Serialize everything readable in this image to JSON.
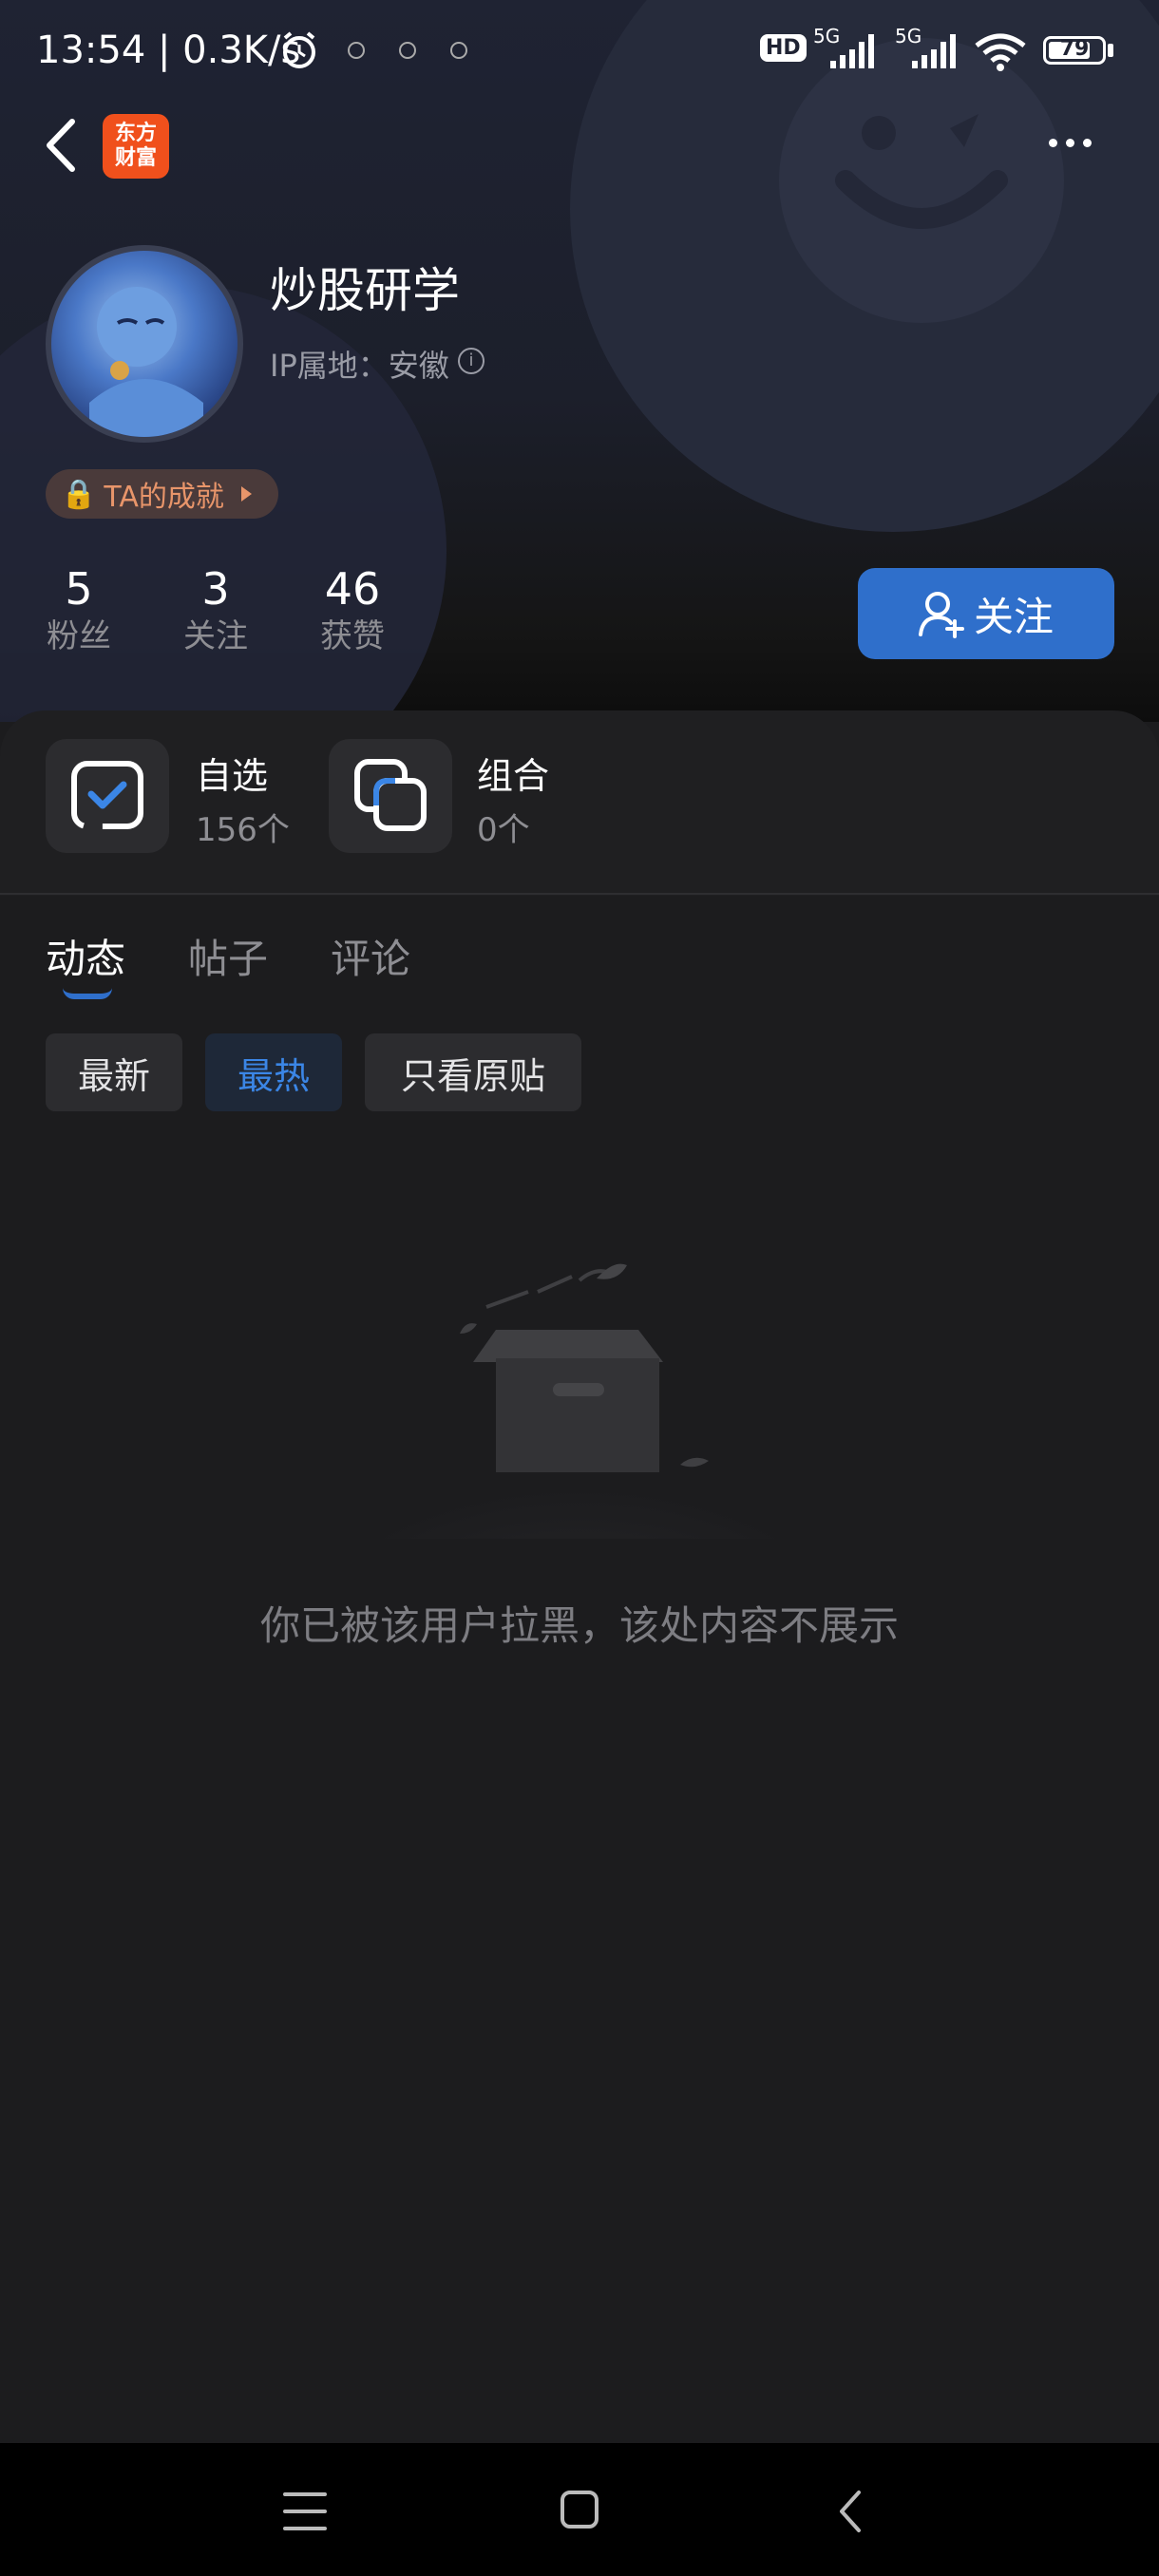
{
  "status_bar": {
    "time": "13:54 | 0.3K/s",
    "hd_label": "HD",
    "network_1": "5G",
    "network_2": "5G",
    "battery": "79",
    "battery_level": 0.79
  },
  "nav": {
    "app_logo_text": "东方财富"
  },
  "profile": {
    "nickname": "炒股研学",
    "ip_location": "IP属地：安徽",
    "achievement_label": "TA的成就",
    "stats": [
      {
        "value": "5",
        "label": "粉丝"
      },
      {
        "value": "3",
        "label": "关注"
      },
      {
        "value": "46",
        "label": "获赞"
      }
    ],
    "follow_label": "关注"
  },
  "assets": [
    {
      "title": "自选",
      "count": "156个"
    },
    {
      "title": "组合",
      "count": "0个"
    }
  ],
  "tabs": [
    {
      "label": "动态",
      "active": true
    },
    {
      "label": "帖子",
      "active": false
    },
    {
      "label": "评论",
      "active": false
    }
  ],
  "filters": [
    {
      "label": "最新",
      "selected": false
    },
    {
      "label": "最热",
      "selected": true
    },
    {
      "label": "只看原贴",
      "selected": false
    }
  ],
  "empty_state": {
    "message": "你已被该用户拉黑，该处内容不展示"
  },
  "colors": {
    "accent": "#2f6fcb",
    "brand_logo": "#f0501c",
    "achievement_text": "#e8956a",
    "background": "#1c1c1e"
  }
}
